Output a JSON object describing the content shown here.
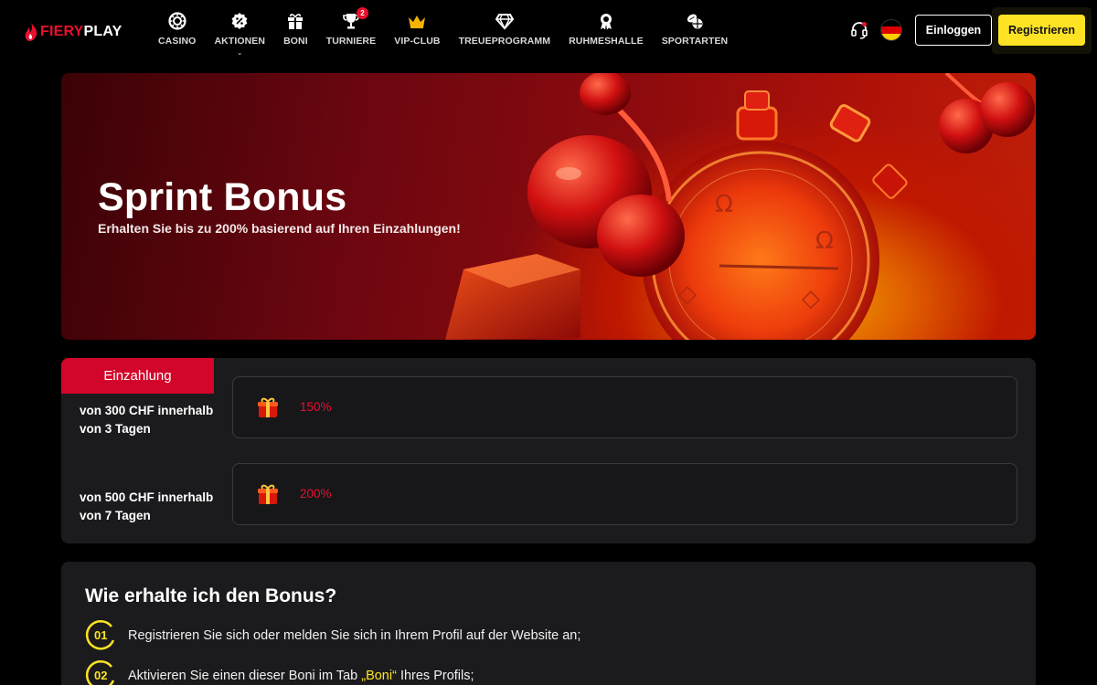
{
  "header": {
    "logo": {
      "part1": "FIERY",
      "part2": "PLAY"
    },
    "nav": [
      {
        "label": "CASINO",
        "icon": "casino-chip-icon"
      },
      {
        "label": "AKTIONEN",
        "icon": "percent-badge-icon",
        "dropdown": true
      },
      {
        "label": "BONI",
        "icon": "gift-icon"
      },
      {
        "label": "TURNIERE",
        "icon": "trophy-icon",
        "badge": "2"
      },
      {
        "label": "VIP-CLUB",
        "icon": "crown-icon"
      },
      {
        "label": "TREUEPROGRAMM",
        "icon": "diamond-icon"
      },
      {
        "label": "RUHMESHALLE",
        "icon": "award-icon"
      },
      {
        "label": "SPORTARTEN",
        "icon": "sports-ball-icon"
      }
    ],
    "login_label": "Einloggen",
    "register_label": "Registrieren",
    "language_flag": "german-flag-icon"
  },
  "hero": {
    "title": "Sprint Bonus",
    "subtitle": "Erhalten Sie bis zu 200% basierend auf Ihren Einzahlungen!"
  },
  "deposit": {
    "tab_label": "Einzahlung",
    "rows": [
      {
        "line1": "von 300 CHF innerhalb",
        "line2": "von 3 Tagen",
        "percent": "150%"
      },
      {
        "line1": "von 500 CHF innerhalb",
        "line2": "von 7 Tagen",
        "percent": "200%"
      }
    ]
  },
  "howto": {
    "title": "Wie erhalte ich den Bonus?",
    "steps": [
      {
        "num": "01",
        "text": "Registrieren Sie sich oder melden Sie sich in Ihrem Profil auf der Website an;"
      },
      {
        "num": "02",
        "text_before": "Aktivieren Sie einen dieser Boni im Tab ",
        "highlight": "„Boni“",
        "text_after": " Ihres Profils;"
      }
    ]
  },
  "colors": {
    "brand_red": "#e8102e",
    "accent_yellow": "#fde323",
    "panel_bg": "#1b1b1e"
  }
}
